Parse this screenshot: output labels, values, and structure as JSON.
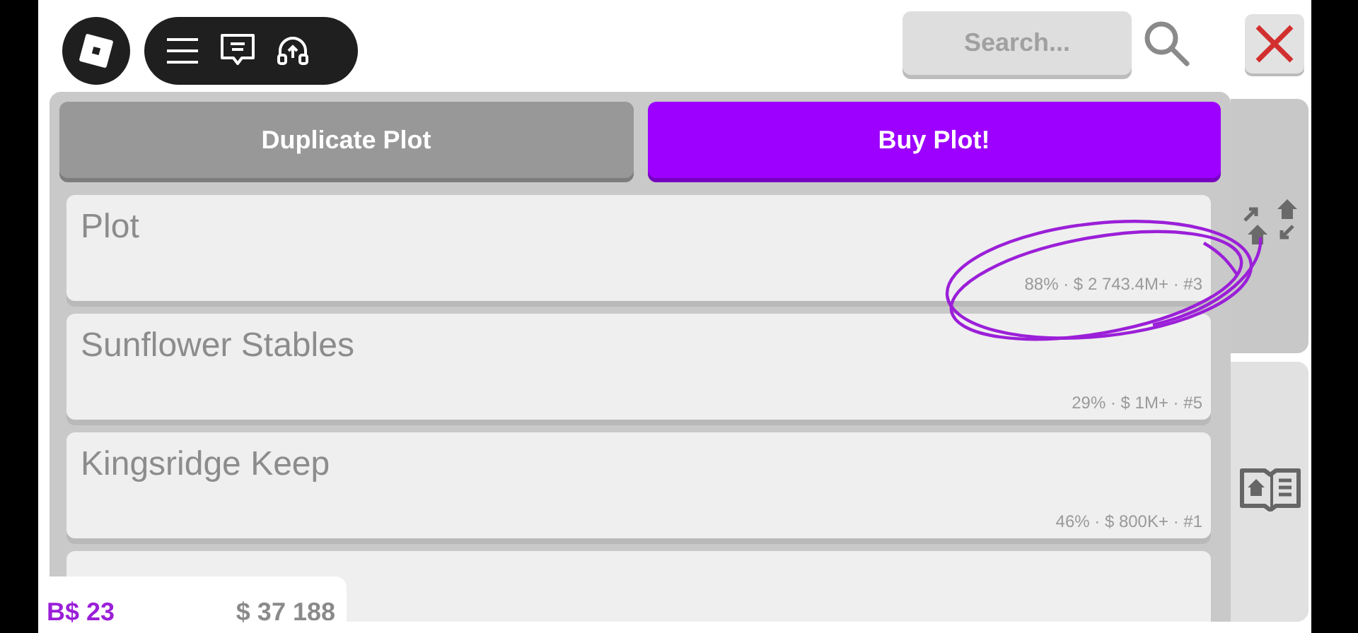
{
  "search": {
    "placeholder": "Search..."
  },
  "actions": [
    {
      "label": "Duplicate Plot",
      "kind": "secondary"
    },
    {
      "label": "Buy Plot!",
      "kind": "primary"
    }
  ],
  "plots": [
    {
      "kind": "listed",
      "name": "Plot",
      "stats": "88% · $ 2 743.4M+ · #3"
    },
    {
      "kind": "listed",
      "name": "Sunflower Stables",
      "stats": "29% · $ 1M+ · #5"
    },
    {
      "kind": "listed",
      "name": "Kingsridge Keep",
      "stats": "46% · $ 800K+ · #1"
    },
    {
      "kind": "covered"
    }
  ],
  "side_tabs": [
    {
      "kind": "plots",
      "selected": true
    },
    {
      "kind": "guide",
      "selected": false
    }
  ],
  "balance": {
    "robux": "B$ 23",
    "cash": "$ 37 188"
  }
}
